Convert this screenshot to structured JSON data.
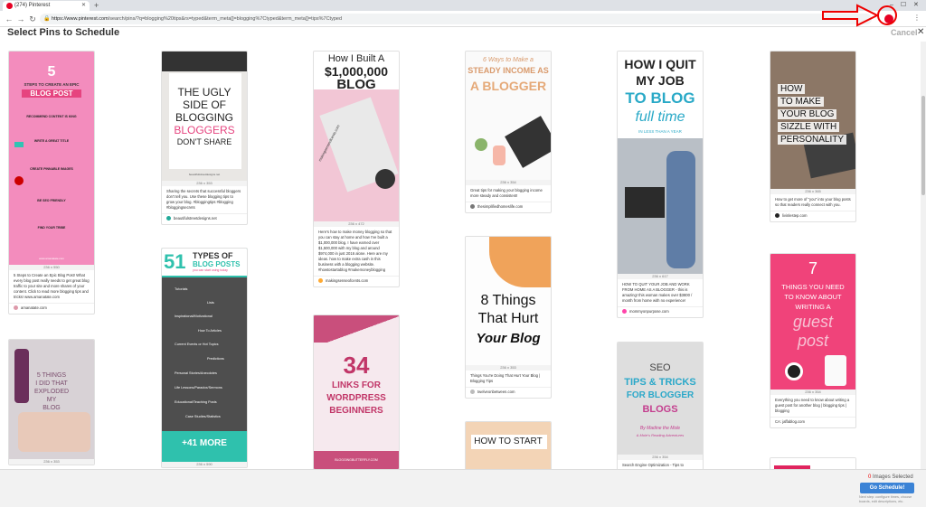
{
  "browser": {
    "tab_title": "(274) Pinterest",
    "new_tab": "+",
    "url_host": "https://www.pinterest.com",
    "url_path": "/search/pins/?q=blogging%20tips&rs=typed&term_meta[]=blogging%7Ctyped&term_meta[]=tips%7Ctyped",
    "minimize": "–",
    "maximize": "☐",
    "close": "✕"
  },
  "modal": {
    "title": "Select Pins to Schedule",
    "cancel": "Cancel",
    "close": "✕"
  },
  "pins": [
    {
      "img_lines": [
        "5",
        "STEPS TO CREATE AN EPIC",
        "BLOG POST",
        "RECOMMEND CONTENT IS KING",
        "WRITE A GREAT TITLE",
        "CREATE PINNABLE IMAGES",
        "BE SEO FRIENDLY",
        "FIND YOUR TRIBE",
        "www.amanatate.com"
      ],
      "dims": "236 x 550",
      "desc": "5 Steps to Create an Epic Blog Post! What every blog post really needs to get great blog traffic to your site and more shares of your content. Click to read more blogging tips and tricks! www.amanatate.com",
      "source": "amanatate.com"
    },
    {
      "img_lines": [
        "5 THINGS",
        "I DID THAT",
        "EXPLODED",
        "MY",
        "BLOG"
      ],
      "dims": "236 x 353"
    },
    {
      "img_lines": [
        "THE UGLY",
        "SIDE OF",
        "BLOGGING",
        "BLOGGERS",
        "DON'T SHARE",
        "beautifulstreetdesigns.net"
      ],
      "dims": "236 x 353",
      "desc": "Sharing the secrets that successful bloggers don't tell you. Use these blogging tips to grow your blog. #bloggingtips #blogging #bloggingsecrets",
      "source": "beautifulstreetdesigns.net"
    },
    {
      "img_lines": [
        "51",
        "TYPES OF",
        "BLOG POSTS",
        "you can start using today",
        "Tutorials",
        "Lists",
        "Inspirational/Motivational",
        "How To Articles",
        "Current Events or Hot Topics",
        "Predictions",
        "Personal Stories/Anecdotes",
        "Life Lessons/Paradox/Sermons",
        "Educational/Teaching Posts",
        "Case Studies/Statistics",
        "+41 MORE"
      ],
      "dims": "236 x 590"
    },
    {
      "img_lines": [
        "How I Built A",
        "$1,000,000",
        "BLOG",
        "makingsenseofcents.com"
      ],
      "dims": "236 x 472",
      "desc": "Here's how to make money blogging so that you can stay at home and how I've built a $1,000,000 blog. I have earned over $1,500,000 with my blog and around $974,000 in just 2016 alone. Here are my ideas. how to make extra cash in this business with a blogging website. #howtostartablog #makemoneyblogging",
      "source": "makingsenseofcents.com"
    },
    {
      "img_lines": [
        "34",
        "LINKS FOR",
        "WORDPRESS",
        "BEGINNERS",
        "BLOGGINGBUTTERFLY.COM"
      ]
    },
    {
      "img_lines": [
        "6 Ways to Make a",
        "STEADY INCOME AS",
        "A BLOGGER"
      ],
      "dims": "236 x 354",
      "desc": "Great tips for making your blogging income more steady and consistent!",
      "source": "thesimplifiedhomeslife.com"
    },
    {
      "img_lines": [
        "8 Things",
        "That Hurt",
        "Your Blog"
      ],
      "dims": "236 x 353",
      "desc": "Things You're Doing That Hurt Your Blog | Blogging Tips",
      "source": "twelveonbetween.com"
    },
    {
      "img_lines": [
        "HOW TO START"
      ]
    },
    {
      "img_lines": [
        "HOW I QUIT",
        "MY JOB",
        "TO BLOG",
        "full time",
        "IN LESS THAN A YEAR"
      ],
      "dims": "236 x 617",
      "desc": "HOW TO QUIT YOUR JOB AND WORK FROM HOME AS A BLOGGER - this is amazing! this woman makes over $3800 / month from home with no experience!",
      "source": "mommyonpurpose.com"
    },
    {
      "img_lines": [
        "SEO",
        "TIPS & TRICKS",
        "FOR BLOGGER",
        "BLOGS",
        "By Madine the Mole",
        "& Mole's Reading Adventures"
      ],
      "dims": "236 x 354",
      "desc": "Search Engine Optimization - Tips to"
    },
    {
      "img_lines": [
        "HOW",
        "TO MAKE",
        "YOUR BLOG",
        "SIZZLE WITH",
        "PERSONALITY"
      ],
      "dims": "236 x 365",
      "desc": "How to get more of \"you\" into your blog posts so that readers really connect with you.",
      "source": "livinlestep.com"
    },
    {
      "img_lines": [
        "7",
        "THINGS YOU NEED",
        "TO KNOW ABOUT",
        "WRITING A",
        "guest",
        "post"
      ],
      "dims": "236 x 354",
      "desc": "Everything you need to know about writing a guest post for another blog | blogging tips | blogging",
      "source": "CA: jaffablog.com"
    }
  ],
  "footer": {
    "count": "0",
    "count_label": "Images Selected",
    "go_button": "Go Schedule!",
    "hint": "Next step: configure times, choose boards, edit descriptions, etc."
  }
}
